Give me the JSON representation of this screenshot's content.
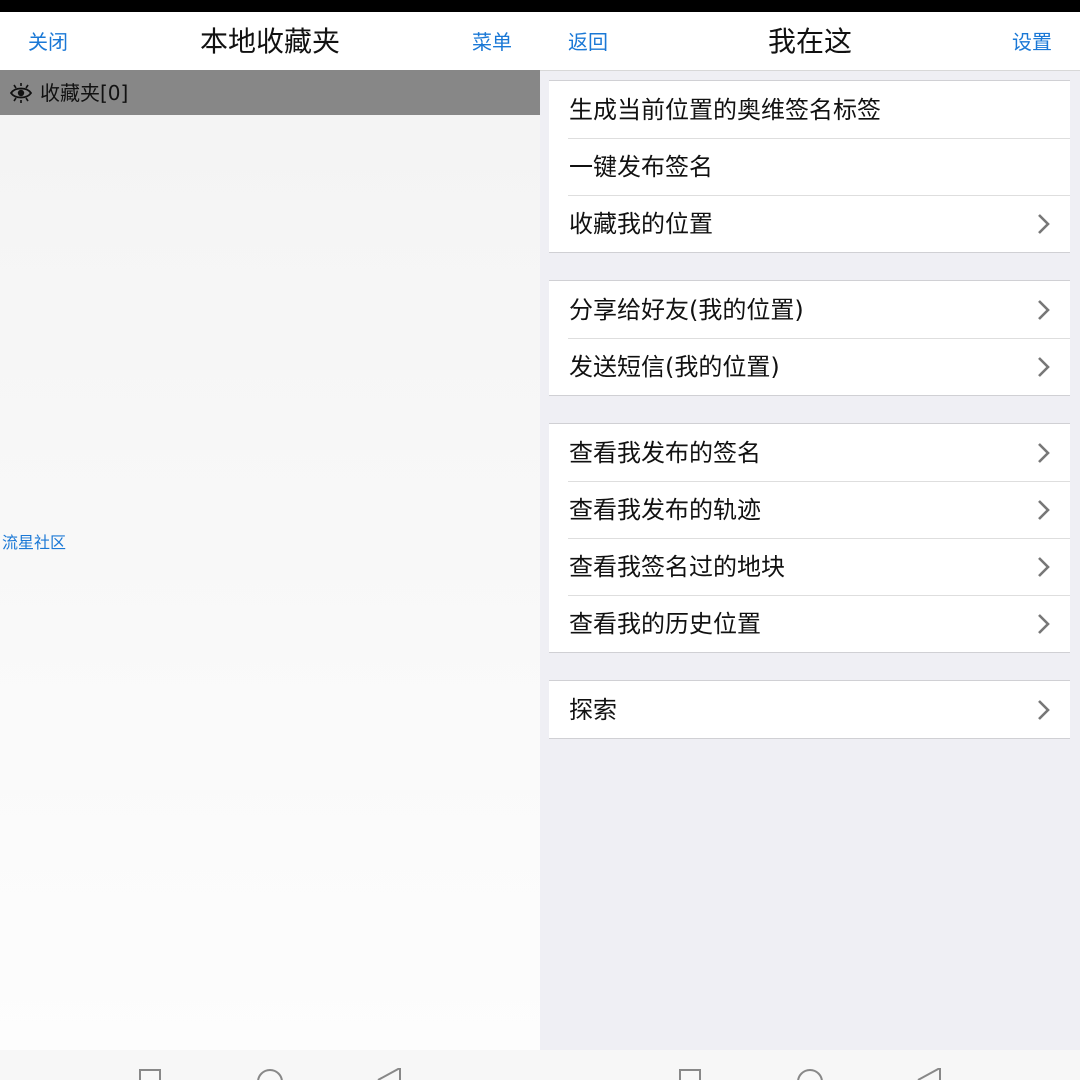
{
  "left_pane": {
    "nav": {
      "close_label": "关闭",
      "title": "本地收藏夹",
      "menu_label": "菜单"
    },
    "folder": {
      "label": "收藏夹[0]",
      "icon": "eye-icon"
    },
    "community_link": "流星社区"
  },
  "right_pane": {
    "nav": {
      "back_label": "返回",
      "title": "我在这",
      "settings_label": "设置"
    },
    "groups": [
      {
        "rows": [
          {
            "label": "生成当前位置的奥维签名标签",
            "chevron": false
          },
          {
            "label": "一键发布签名",
            "chevron": false
          },
          {
            "label": "收藏我的位置",
            "chevron": true
          }
        ]
      },
      {
        "rows": [
          {
            "label": "分享给好友(我的位置)",
            "chevron": true
          },
          {
            "label": "发送短信(我的位置)",
            "chevron": true
          }
        ]
      },
      {
        "rows": [
          {
            "label": "查看我发布的签名",
            "chevron": true
          },
          {
            "label": "查看我发布的轨迹",
            "chevron": true
          },
          {
            "label": "查看我签名过的地块",
            "chevron": true
          },
          {
            "label": "查看我的历史位置",
            "chevron": true
          }
        ]
      },
      {
        "rows": [
          {
            "label": "探索",
            "chevron": true
          }
        ]
      }
    ]
  },
  "colors": {
    "accent": "#1a78d6",
    "folder_bar": "#878787",
    "right_background": "#efeff4"
  }
}
